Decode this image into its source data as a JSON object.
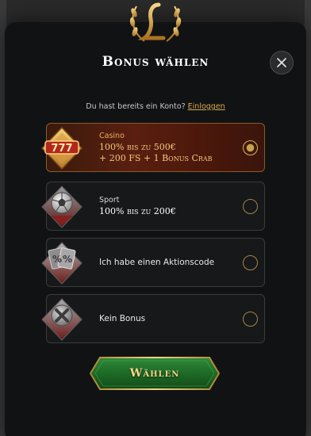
{
  "modal": {
    "title": "Bonus wählen",
    "close_icon": "close-icon",
    "login_prompt": "Du hast bereits ein Konto?",
    "login_link": "Einloggen"
  },
  "options": [
    {
      "category": "Casino",
      "line1": "100% bis zu 500€",
      "line2": "+ 200 FS + 1 Bonus Crab",
      "icon": "slot-machine-777-icon",
      "selected": true
    },
    {
      "category": "Sport",
      "line1": "100% bis zu 200€",
      "icon": "soccer-ball-icon",
      "selected": false
    },
    {
      "label": "Ich habe einen Aktionscode",
      "icon": "percent-coupon-icon",
      "selected": false
    },
    {
      "label": "Kein Bonus",
      "icon": "no-bonus-icon",
      "selected": false
    }
  ],
  "submit": {
    "label": "Wählen"
  },
  "colors": {
    "accent_gold": "#d9a84a",
    "button_green": "#1f6a2a",
    "modal_bg": "#111214",
    "selected_bg": "#5a1f10"
  }
}
